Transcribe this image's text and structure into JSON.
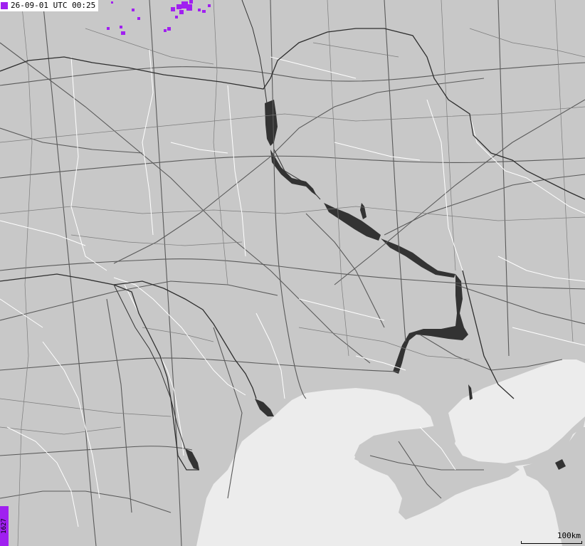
{
  "legend": {
    "timestamp": "26-09-01 UTC 00:25",
    "swatch_color": "#a020f0"
  },
  "strike_count": "1627",
  "scale": {
    "label": "100km"
  },
  "colors": {
    "land": "#c8c8c8",
    "sea": "#ececec",
    "water": "#333333",
    "border": "#ffffff",
    "road": "#5a5a5a",
    "strike": "#a020f0"
  }
}
